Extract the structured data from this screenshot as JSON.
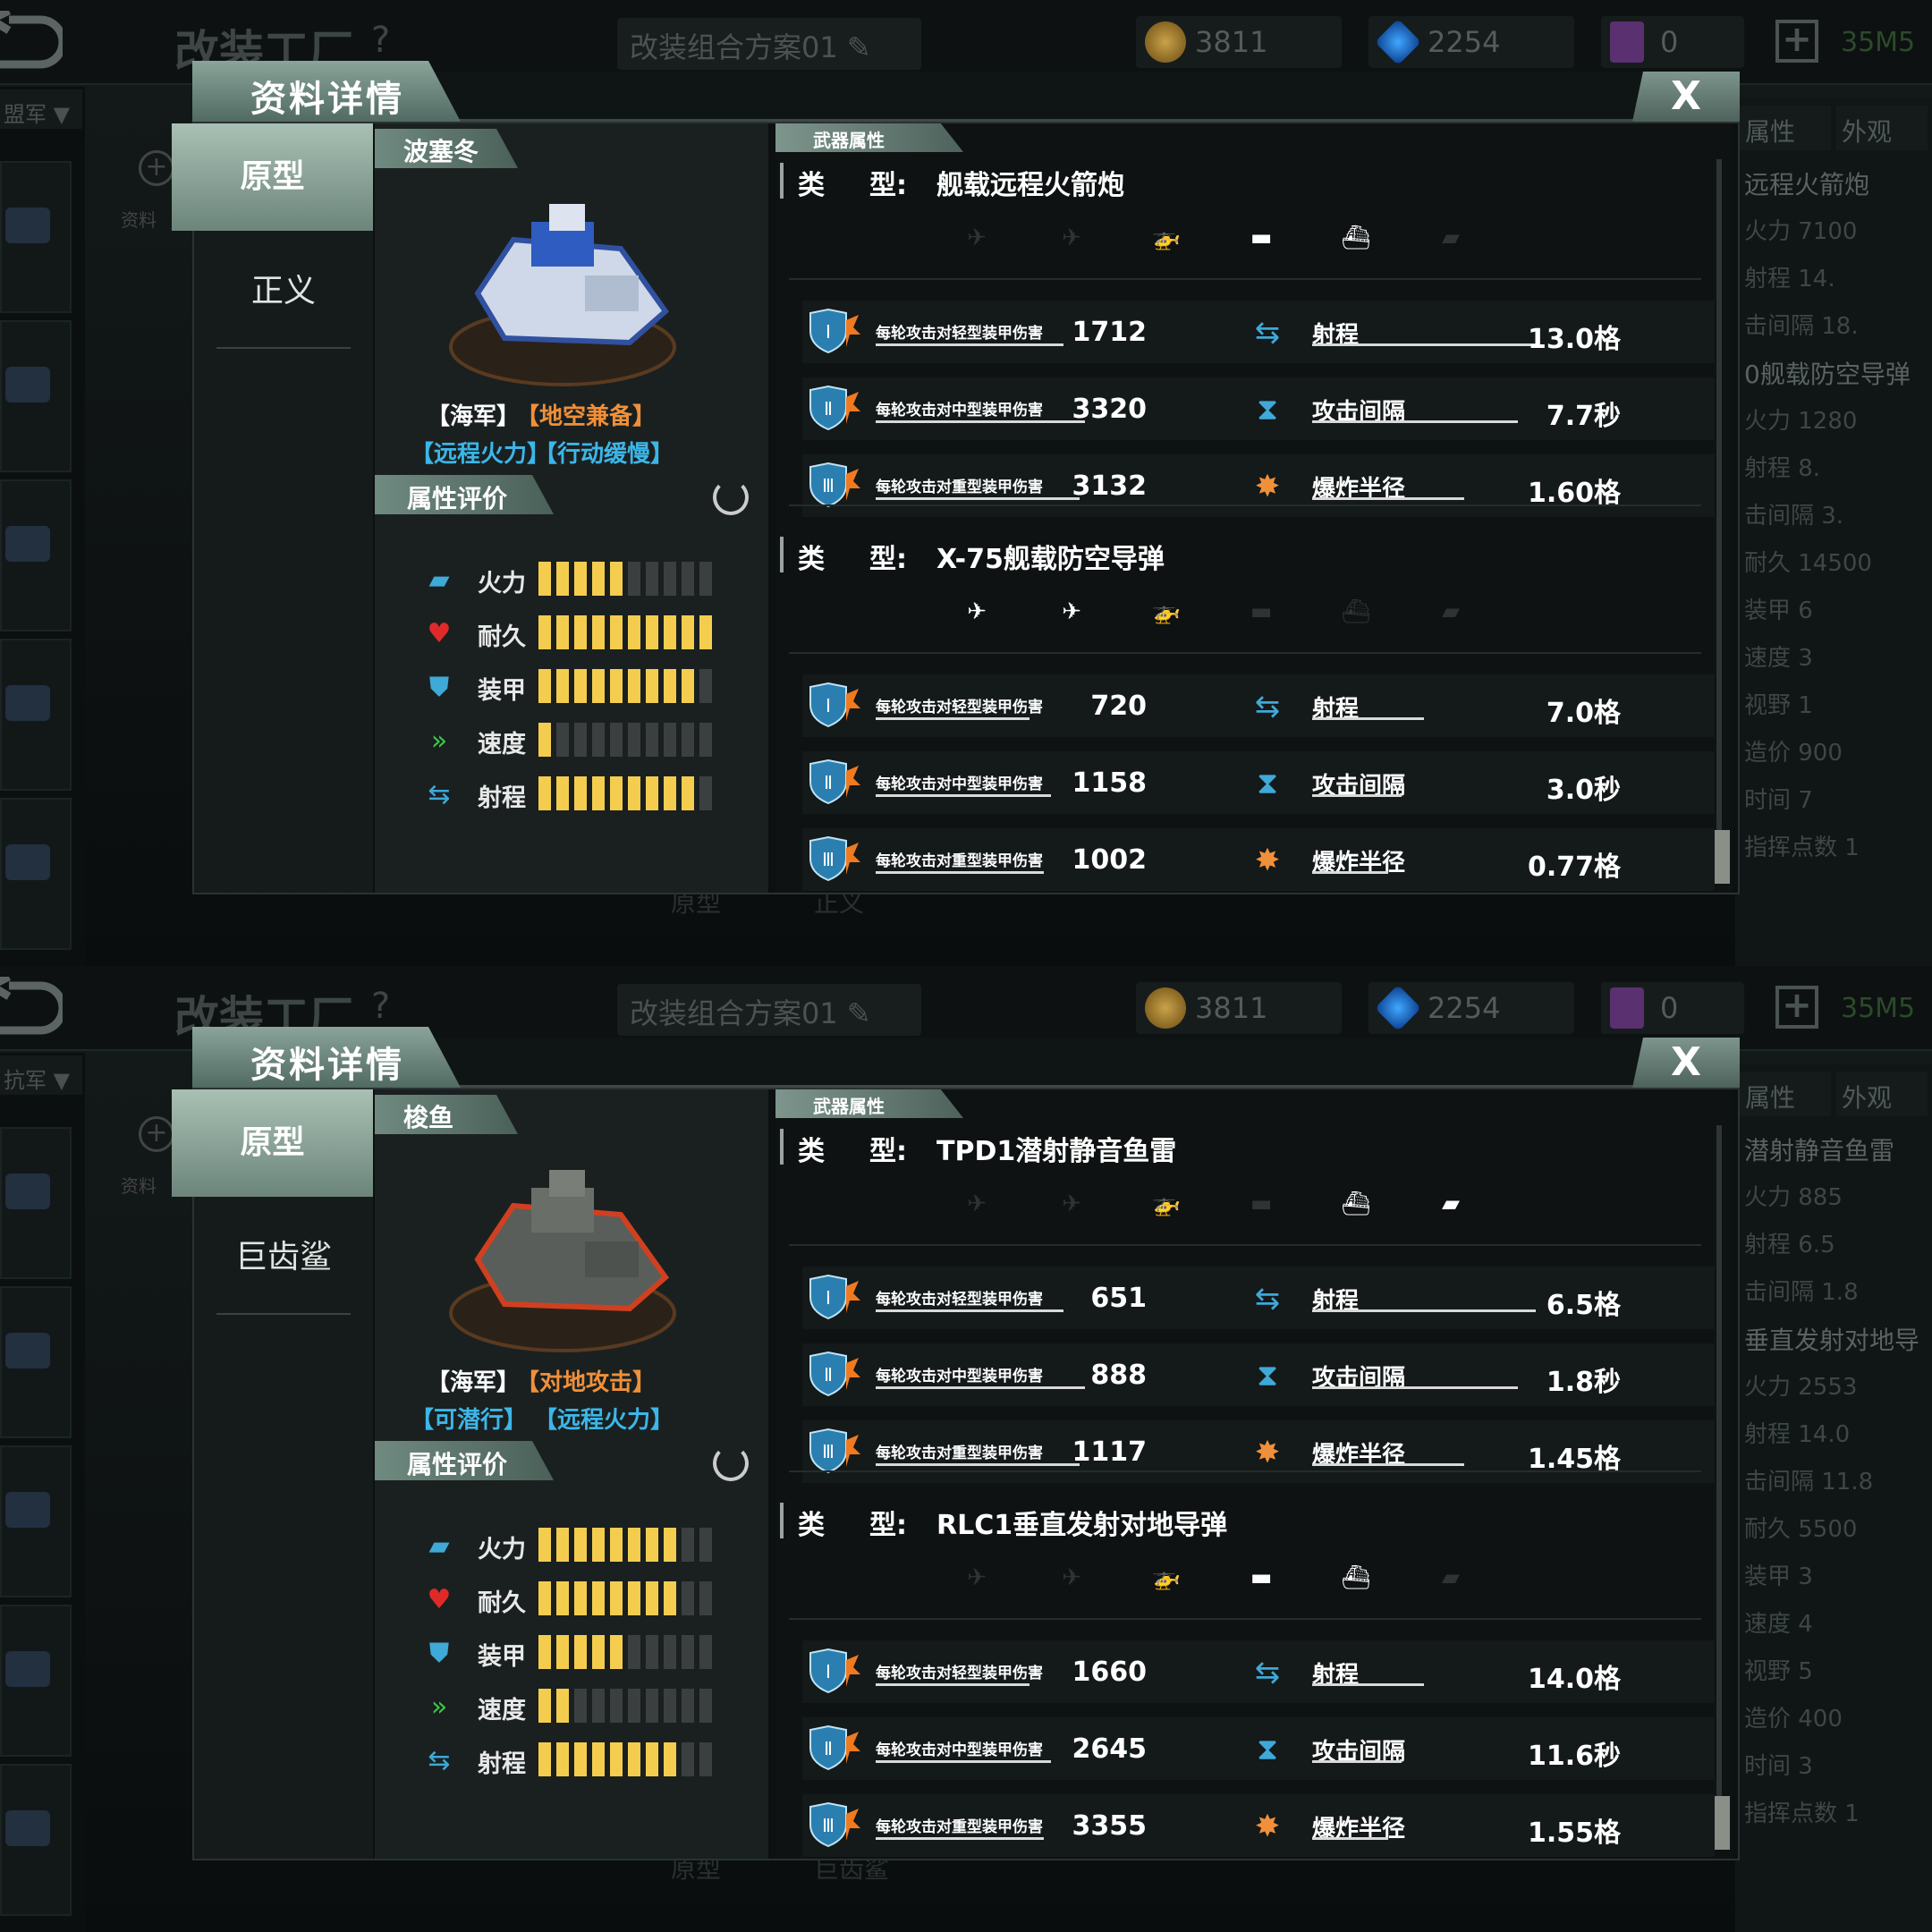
{
  "app": {
    "title": "改装工厂",
    "help": "?",
    "plan": "改装组合方案01",
    "gold": "3811",
    "diamond": "2254",
    "card": "0",
    "code": "35M5",
    "left_dropdowns": [
      "盟军",
      "抗军"
    ],
    "side_label": "资料",
    "right_tabs": [
      "属性",
      "外观"
    ]
  },
  "screens": [
    {
      "dialog_title": "资料详情",
      "close": "X",
      "tabs": [
        "原型",
        "正义"
      ],
      "unit_name": "波塞冬",
      "tags": [
        "【海军】",
        "【地空兼备】",
        "【远程火力】",
        "【行动缓慢】"
      ],
      "tag_colors": [
        "#ffffff",
        "#f0903a",
        "#3cb6e8",
        "#3cb6e8"
      ],
      "eval_title": "属性评价",
      "attrs": [
        {
          "label": "火力",
          "level": 5,
          "icon": "firepower-icon"
        },
        {
          "label": "耐久",
          "level": 10,
          "icon": "heart-icon"
        },
        {
          "label": "装甲",
          "level": 9,
          "icon": "shield-icon"
        },
        {
          "label": "速度",
          "level": 1,
          "icon": "speed-chevron-icon"
        },
        {
          "label": "射程",
          "level": 9,
          "icon": "range-arrow-icon"
        }
      ],
      "weapon_section": "武器属性",
      "type_label": "类",
      "type_label2": "型:",
      "weapons": [
        {
          "name": "舰载远程火箭炮",
          "targets": [
            false,
            false,
            false,
            true,
            true,
            false
          ],
          "rows": [
            {
              "dmg_label": "每轮攻击对轻型装甲伤害",
              "dmg": "1712",
              "stat_label": "射程",
              "stat": "13.0格"
            },
            {
              "dmg_label": "每轮攻击对中型装甲伤害",
              "dmg": "3320",
              "stat_label": "攻击间隔",
              "stat": "7.7秒"
            },
            {
              "dmg_label": "每轮攻击对重型装甲伤害",
              "dmg": "3132",
              "stat_label": "爆炸半径",
              "stat": "1.60格"
            }
          ]
        },
        {
          "name": "X-75舰载防空导弹",
          "targets": [
            true,
            true,
            true,
            false,
            false,
            false
          ],
          "rows": [
            {
              "dmg_label": "每轮攻击对轻型装甲伤害",
              "dmg": "720",
              "stat_label": "射程",
              "stat": "7.0格"
            },
            {
              "dmg_label": "每轮攻击对中型装甲伤害",
              "dmg": "1158",
              "stat_label": "攻击间隔",
              "stat": "3.0秒"
            },
            {
              "dmg_label": "每轮攻击对重型装甲伤害",
              "dmg": "1002",
              "stat_label": "爆炸半径",
              "stat": "0.77格"
            }
          ]
        }
      ],
      "right_panel": [
        "远程火箭炮",
        "火力 7100",
        "射程 14.",
        "击间隔 18.",
        "0舰载防空导弹",
        "火力 1280",
        "射程 8.",
        "击间隔 3.",
        "耐久 14500",
        "装甲 6",
        "速度 3",
        "视野 1",
        "造价 900",
        "时间 7",
        "指挥点数 1"
      ],
      "bottom_tabs": [
        "原型",
        "正义"
      ]
    },
    {
      "dialog_title": "资料详情",
      "close": "X",
      "tabs": [
        "原型",
        "巨齿鲨"
      ],
      "unit_name": "梭鱼",
      "tags": [
        "【海军】",
        "【对地攻击】",
        "【可潜行】",
        "【远程火力】"
      ],
      "tag_colors": [
        "#ffffff",
        "#f0903a",
        "#3cb6e8",
        "#3cb6e8"
      ],
      "eval_title": "属性评价",
      "attrs": [
        {
          "label": "火力",
          "level": 8,
          "icon": "firepower-icon"
        },
        {
          "label": "耐久",
          "level": 8,
          "icon": "heart-icon"
        },
        {
          "label": "装甲",
          "level": 5,
          "icon": "shield-icon"
        },
        {
          "label": "速度",
          "level": 2,
          "icon": "speed-chevron-icon"
        },
        {
          "label": "射程",
          "level": 8,
          "icon": "range-arrow-icon"
        }
      ],
      "weapon_section": "武器属性",
      "type_label": "类",
      "type_label2": "型:",
      "weapons": [
        {
          "name": "TPD1潜射静音鱼雷",
          "targets": [
            false,
            false,
            false,
            false,
            true,
            true
          ],
          "rows": [
            {
              "dmg_label": "每轮攻击对轻型装甲伤害",
              "dmg": "651",
              "stat_label": "射程",
              "stat": "6.5格"
            },
            {
              "dmg_label": "每轮攻击对中型装甲伤害",
              "dmg": "888",
              "stat_label": "攻击间隔",
              "stat": "1.8秒"
            },
            {
              "dmg_label": "每轮攻击对重型装甲伤害",
              "dmg": "1117",
              "stat_label": "爆炸半径",
              "stat": "1.45格"
            }
          ]
        },
        {
          "name": "RLC1垂直发射对地导弹",
          "targets": [
            false,
            false,
            false,
            true,
            true,
            false
          ],
          "rows": [
            {
              "dmg_label": "每轮攻击对轻型装甲伤害",
              "dmg": "1660",
              "stat_label": "射程",
              "stat": "14.0格"
            },
            {
              "dmg_label": "每轮攻击对中型装甲伤害",
              "dmg": "2645",
              "stat_label": "攻击间隔",
              "stat": "11.6秒"
            },
            {
              "dmg_label": "每轮攻击对重型装甲伤害",
              "dmg": "3355",
              "stat_label": "爆炸半径",
              "stat": "1.55格"
            }
          ]
        }
      ],
      "right_panel": [
        "潜射静音鱼雷",
        "火力 885",
        "射程 6.5",
        "击间隔 1.8",
        "垂直发射对地导",
        "火力 2553",
        "射程 14.0",
        "击间隔 11.8",
        "耐久 5500",
        "装甲 3",
        "速度 4",
        "视野 5",
        "造价 400",
        "时间 3",
        "指挥点数 1"
      ],
      "bottom_tabs": [
        "原型",
        "巨齿鲨"
      ]
    }
  ]
}
